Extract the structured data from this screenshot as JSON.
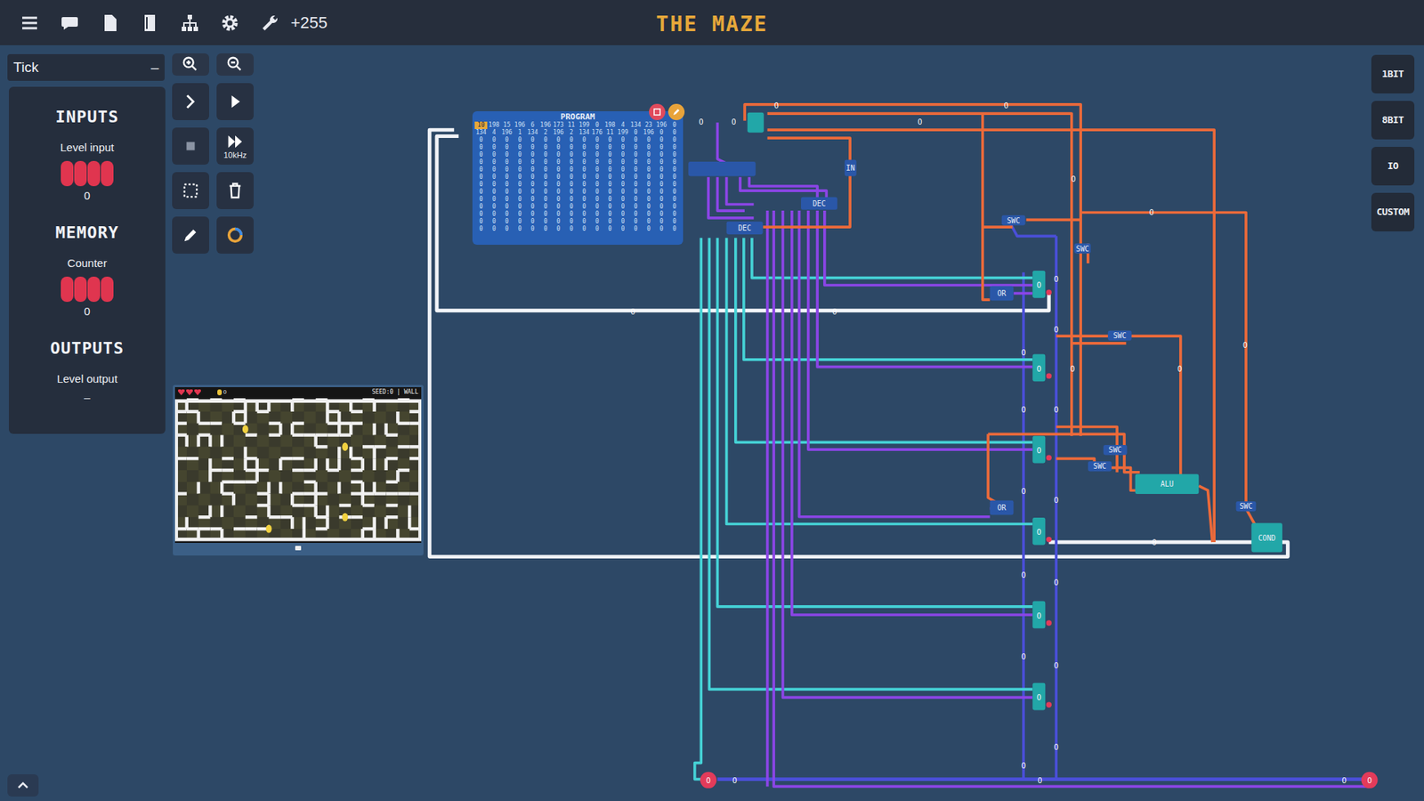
{
  "top_bar": {
    "score": "+255",
    "title": "THE MAZE"
  },
  "left_panel": {
    "tick_select": {
      "label": "Tick",
      "collapse": "–"
    },
    "sections": [
      {
        "title": "INPUTS",
        "items": [
          {
            "label": "Level input",
            "value": "0"
          }
        ]
      },
      {
        "title": "MEMORY",
        "items": [
          {
            "label": "Counter",
            "value": "0"
          }
        ]
      },
      {
        "title": "OUTPUTS",
        "items": [
          {
            "label": "Level output",
            "value": "–"
          }
        ]
      }
    ]
  },
  "toolbar": {
    "speed": "10kHz"
  },
  "palette": [
    {
      "label": "1BIT"
    },
    {
      "label": "8BIT"
    },
    {
      "label": "IO"
    },
    {
      "label": "CUSTOM"
    }
  ],
  "maze": {
    "status": "SEED:0 | WALL",
    "coins": "0"
  },
  "program": {
    "title": "PROGRAM",
    "cursor_row": 0,
    "cursor_col": 0,
    "rows": [
      [
        "10",
        "198",
        "15",
        "196",
        "6",
        "196",
        "173",
        "11",
        "199",
        "0",
        "198",
        "4",
        "134",
        "23",
        "196",
        "0"
      ],
      [
        "134",
        "4",
        "196",
        "1",
        "134",
        "2",
        "196",
        "2",
        "134",
        "176",
        "11",
        "199",
        "0",
        "196",
        "0",
        "0"
      ],
      [
        "0",
        "0",
        "0",
        "0",
        "0",
        "0",
        "0",
        "0",
        "0",
        "0",
        "0",
        "0",
        "0",
        "0",
        "0",
        "0"
      ],
      [
        "0",
        "0",
        "0",
        "0",
        "0",
        "0",
        "0",
        "0",
        "0",
        "0",
        "0",
        "0",
        "0",
        "0",
        "0",
        "0"
      ],
      [
        "0",
        "0",
        "0",
        "0",
        "0",
        "0",
        "0",
        "0",
        "0",
        "0",
        "0",
        "0",
        "0",
        "0",
        "0",
        "0"
      ],
      [
        "0",
        "0",
        "0",
        "0",
        "0",
        "0",
        "0",
        "0",
        "0",
        "0",
        "0",
        "0",
        "0",
        "0",
        "0",
        "0"
      ],
      [
        "0",
        "0",
        "0",
        "0",
        "0",
        "0",
        "0",
        "0",
        "0",
        "0",
        "0",
        "0",
        "0",
        "0",
        "0",
        "0"
      ],
      [
        "0",
        "0",
        "0",
        "0",
        "0",
        "0",
        "0",
        "0",
        "0",
        "0",
        "0",
        "0",
        "0",
        "0",
        "0",
        "0"
      ],
      [
        "0",
        "0",
        "0",
        "0",
        "0",
        "0",
        "0",
        "0",
        "0",
        "0",
        "0",
        "0",
        "0",
        "0",
        "0",
        "0"
      ],
      [
        "0",
        "0",
        "0",
        "0",
        "0",
        "0",
        "0",
        "0",
        "0",
        "0",
        "0",
        "0",
        "0",
        "0",
        "0",
        "0"
      ],
      [
        "0",
        "0",
        "0",
        "0",
        "0",
        "0",
        "0",
        "0",
        "0",
        "0",
        "0",
        "0",
        "0",
        "0",
        "0",
        "0"
      ],
      [
        "0",
        "0",
        "0",
        "0",
        "0",
        "0",
        "0",
        "0",
        "0",
        "0",
        "0",
        "0",
        "0",
        "0",
        "0",
        "0"
      ],
      [
        "0",
        "0",
        "0",
        "0",
        "0",
        "0",
        "0",
        "0",
        "0",
        "0",
        "0",
        "0",
        "0",
        "0",
        "0",
        "0"
      ],
      [
        "0",
        "0",
        "0",
        "0",
        "0",
        "0",
        "0",
        "0",
        "0",
        "0",
        "0",
        "0",
        "0",
        "0",
        "0",
        "0"
      ],
      [
        "0",
        "0",
        "0",
        "0",
        "0",
        "0",
        "0",
        "0",
        "0",
        "0",
        "0",
        "0",
        "0",
        "0",
        "0",
        "0"
      ]
    ]
  },
  "circuit": {
    "components": [
      {
        "label": "DEC"
      },
      {
        "label": "DEC"
      },
      {
        "label": "IN"
      },
      {
        "label": "OR"
      },
      {
        "label": "OR"
      },
      {
        "label": "SWC"
      },
      {
        "label": "SWC"
      },
      {
        "label": "SWC"
      },
      {
        "label": "SWC"
      },
      {
        "label": "SWC"
      },
      {
        "label": "SWC"
      },
      {
        "label": "ALU"
      },
      {
        "label": "COND"
      }
    ],
    "registers": [
      {
        "value": "0"
      },
      {
        "value": "0"
      },
      {
        "value": "0"
      },
      {
        "value": "0"
      },
      {
        "value": "0"
      },
      {
        "value": "0"
      }
    ],
    "pins": [
      {
        "value": "0"
      },
      {
        "value": "0"
      }
    ],
    "wire_values": [
      "0",
      "0",
      "0",
      "0",
      "0",
      "0",
      "0",
      "0",
      "0",
      "0",
      "0",
      "0",
      "0",
      "0",
      "0",
      "0",
      "0",
      "0",
      "0",
      "0",
      "0",
      "0",
      "0",
      "0",
      "0",
      "0",
      "0",
      "0",
      "0"
    ]
  }
}
